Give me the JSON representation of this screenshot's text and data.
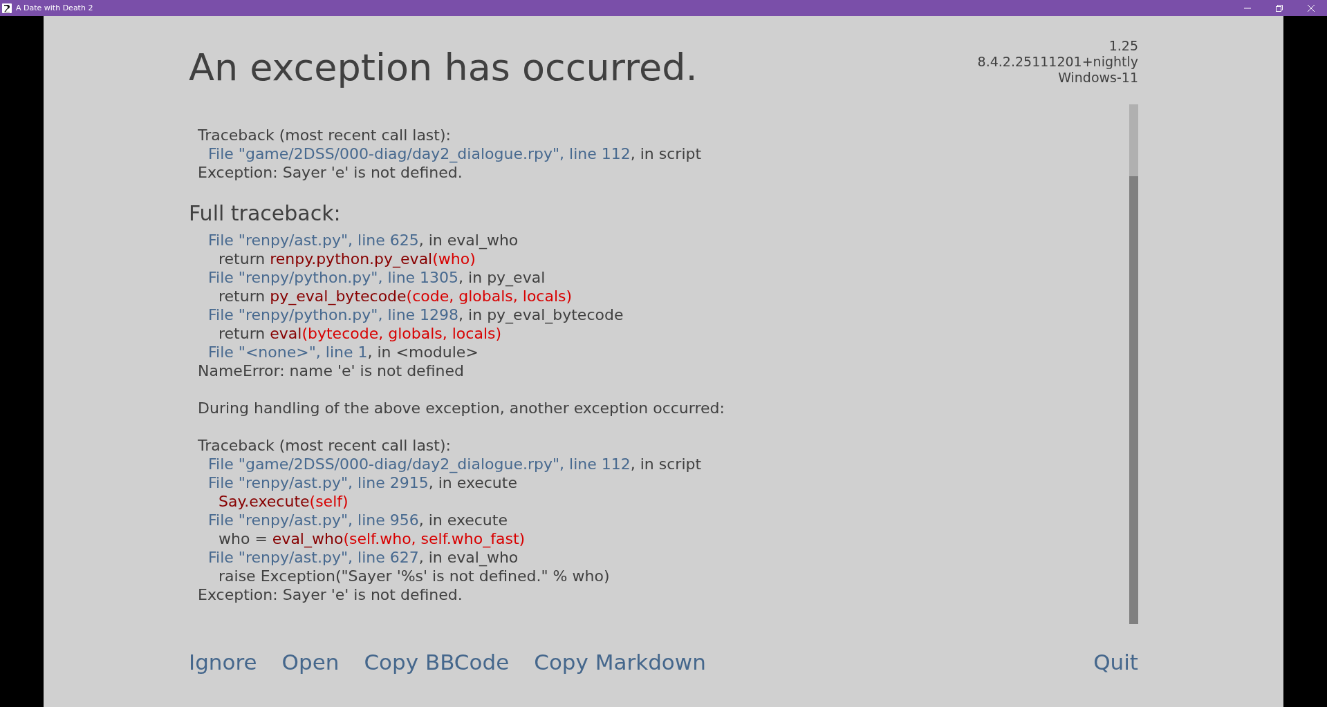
{
  "window": {
    "title": "A Date with Death 2"
  },
  "heading": "An exception has occurred.",
  "version_info": [
    "1.25",
    "8.4.2.25111201+nightly",
    "Windows-11"
  ],
  "traceback": {
    "lines": [
      {
        "kind": "message",
        "parts": [
          {
            "kind": "text",
            "text": "Traceback (most recent call last):"
          }
        ]
      },
      {
        "kind": "frame",
        "parts": [
          {
            "kind": "link",
            "text": "File \"game/2DSS/000-diag/day2_dialogue.rpy\", line 112"
          },
          {
            "kind": "text",
            "text": ", in script"
          }
        ]
      },
      {
        "kind": "message",
        "parts": [
          {
            "kind": "text",
            "text": "Exception: Sayer 'e' is not defined."
          }
        ]
      }
    ]
  },
  "full_traceback": {
    "title": "Full traceback:",
    "lines": [
      {
        "kind": "frame",
        "parts": [
          {
            "kind": "link",
            "text": "File \"renpy/ast.py\", line 625"
          },
          {
            "kind": "text",
            "text": ", in eval_who"
          }
        ]
      },
      {
        "kind": "code",
        "parts": [
          {
            "kind": "text",
            "text": "return "
          },
          {
            "kind": "call",
            "text": "renpy.python.py_eval"
          },
          {
            "kind": "args",
            "text": "(who)"
          }
        ]
      },
      {
        "kind": "frame",
        "parts": [
          {
            "kind": "link",
            "text": "File \"renpy/python.py\", line 1305"
          },
          {
            "kind": "text",
            "text": ", in py_eval"
          }
        ]
      },
      {
        "kind": "code",
        "parts": [
          {
            "kind": "text",
            "text": "return "
          },
          {
            "kind": "call",
            "text": "py_eval_bytecode"
          },
          {
            "kind": "args",
            "text": "(code, globals, locals)"
          }
        ]
      },
      {
        "kind": "frame",
        "parts": [
          {
            "kind": "link",
            "text": "File \"renpy/python.py\", line 1298"
          },
          {
            "kind": "text",
            "text": ", in py_eval_bytecode"
          }
        ]
      },
      {
        "kind": "code",
        "parts": [
          {
            "kind": "text",
            "text": "return "
          },
          {
            "kind": "call",
            "text": "eval"
          },
          {
            "kind": "args",
            "text": "(bytecode, globals, locals)"
          }
        ]
      },
      {
        "kind": "frame",
        "parts": [
          {
            "kind": "link",
            "text": "File \"<none>\", line 1"
          },
          {
            "kind": "text",
            "text": ", in <module>"
          }
        ]
      },
      {
        "kind": "message",
        "parts": [
          {
            "kind": "text",
            "text": "NameError: name 'e' is not defined"
          }
        ]
      },
      {
        "kind": "blank"
      },
      {
        "kind": "message",
        "parts": [
          {
            "kind": "text",
            "text": "During handling of the above exception, another exception occurred:"
          }
        ]
      },
      {
        "kind": "blank"
      },
      {
        "kind": "message",
        "parts": [
          {
            "kind": "text",
            "text": "Traceback (most recent call last):"
          }
        ]
      },
      {
        "kind": "frame",
        "parts": [
          {
            "kind": "link",
            "text": "File \"game/2DSS/000-diag/day2_dialogue.rpy\", line 112"
          },
          {
            "kind": "text",
            "text": ", in script"
          }
        ]
      },
      {
        "kind": "frame",
        "parts": [
          {
            "kind": "link",
            "text": "File \"renpy/ast.py\", line 2915"
          },
          {
            "kind": "text",
            "text": ", in execute"
          }
        ]
      },
      {
        "kind": "code",
        "parts": [
          {
            "kind": "call",
            "text": "Say.execute"
          },
          {
            "kind": "args",
            "text": "(self)"
          }
        ]
      },
      {
        "kind": "frame",
        "parts": [
          {
            "kind": "link",
            "text": "File \"renpy/ast.py\", line 956"
          },
          {
            "kind": "text",
            "text": ", in execute"
          }
        ]
      },
      {
        "kind": "code",
        "parts": [
          {
            "kind": "text",
            "text": "who = "
          },
          {
            "kind": "call",
            "text": "eval_who"
          },
          {
            "kind": "args",
            "text": "(self.who, self.who_fast)"
          }
        ]
      },
      {
        "kind": "frame",
        "parts": [
          {
            "kind": "link",
            "text": "File \"renpy/ast.py\", line 627"
          },
          {
            "kind": "text",
            "text": ", in eval_who"
          }
        ]
      },
      {
        "kind": "code",
        "parts": [
          {
            "kind": "text",
            "text": "raise Exception(\"Sayer '%s' is not defined.\" % who)"
          }
        ]
      },
      {
        "kind": "message",
        "parts": [
          {
            "kind": "text",
            "text": "Exception: Sayer 'e' is not defined."
          }
        ]
      }
    ]
  },
  "buttons": [
    "Ignore",
    "Open",
    "Copy BBCode",
    "Copy Markdown"
  ],
  "quit_button": "Quit"
}
